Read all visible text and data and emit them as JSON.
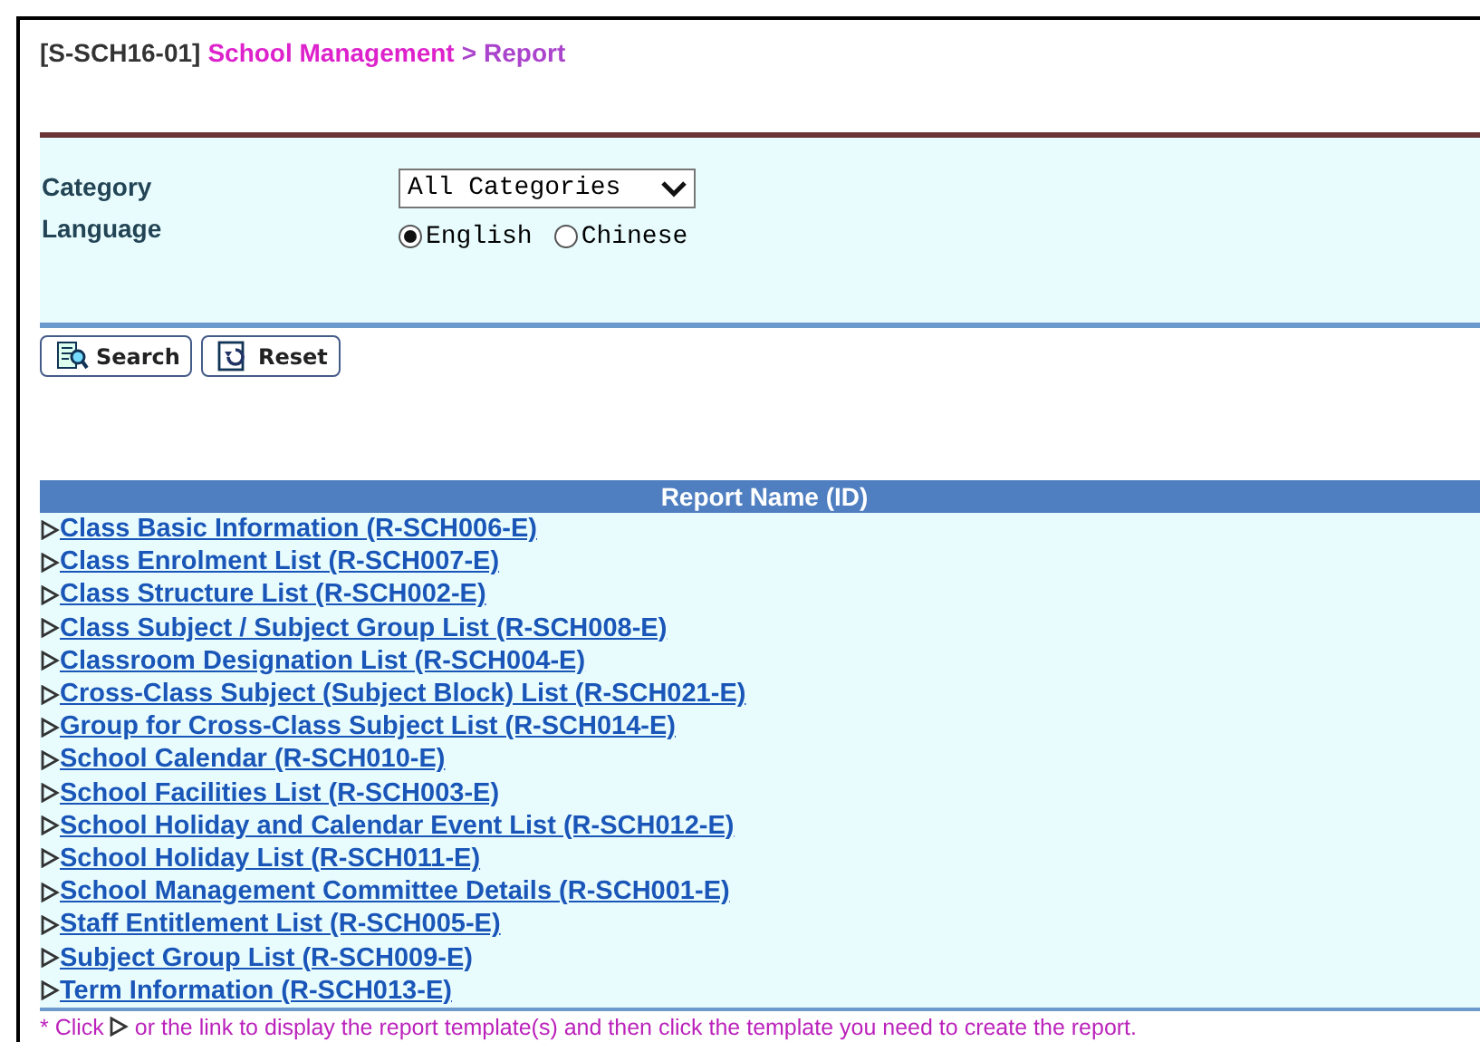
{
  "breadcrumb": {
    "code": "[S-SCH16-01]",
    "module": "School Management",
    "separator": ">",
    "page": "Report"
  },
  "filters": [
    {
      "kind": "select",
      "label": "Category",
      "value": "All Categories"
    },
    {
      "kind": "radio",
      "label": "Language",
      "options": [
        {
          "label": "English",
          "selected": true
        },
        {
          "label": "Chinese",
          "selected": false
        }
      ]
    }
  ],
  "buttons": [
    {
      "kind": "search",
      "label": "Search"
    },
    {
      "kind": "reset",
      "label": "Reset"
    }
  ],
  "table": {
    "header": "Report Name (ID)",
    "rows": [
      {
        "name": "Class Basic Information (R-SCH006-E)"
      },
      {
        "name": "Class Enrolment List (R-SCH007-E)"
      },
      {
        "name": "Class Structure List (R-SCH002-E)"
      },
      {
        "name": "Class Subject / Subject Group List (R-SCH008-E)"
      },
      {
        "name": "Classroom Designation List (R-SCH004-E)"
      },
      {
        "name": "Cross-Class Subject (Subject Block) List (R-SCH021-E)"
      },
      {
        "name": "Group for Cross-Class Subject List (R-SCH014-E)"
      },
      {
        "name": "School Calendar (R-SCH010-E)"
      },
      {
        "name": "School Facilities List (R-SCH003-E)"
      },
      {
        "name": "School Holiday and Calendar Event List (R-SCH012-E)"
      },
      {
        "name": "School Holiday List (R-SCH011-E)"
      },
      {
        "name": "School Management Committee Details (R-SCH001-E)"
      },
      {
        "name": "Staff Entitlement List (R-SCH005-E)"
      },
      {
        "name": "Subject Group List (R-SCH009-E)"
      },
      {
        "name": "Term Information (R-SCH013-E)"
      }
    ]
  },
  "note": {
    "before": "* Click",
    "after": "or the link to display the report template(s) and then click the template you need to create the report."
  }
}
